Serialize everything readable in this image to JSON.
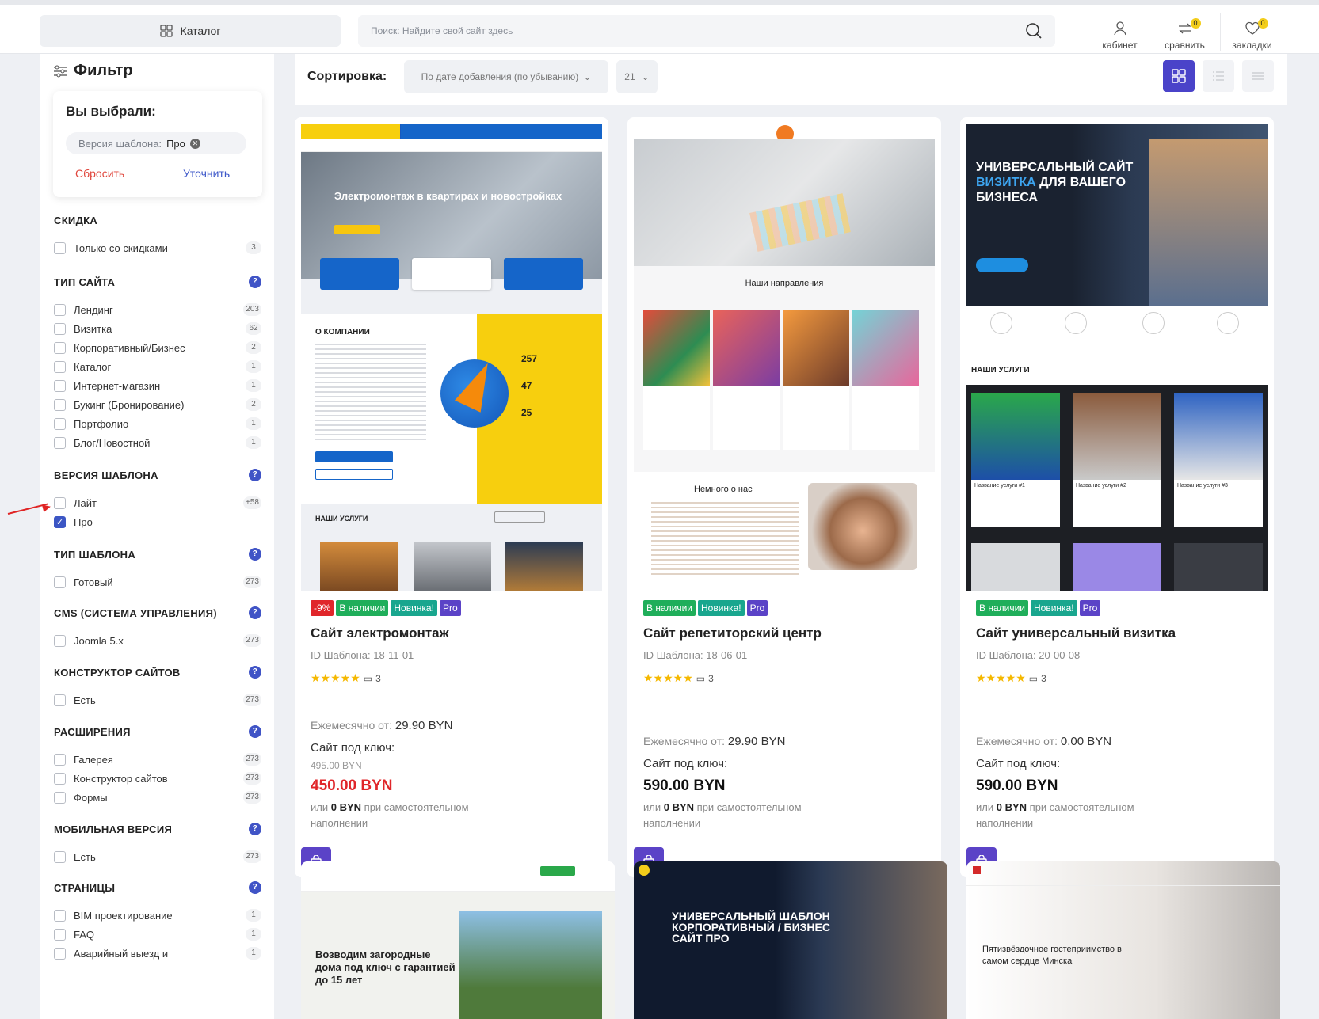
{
  "header": {
    "catalog_label": "Каталог",
    "search_placeholder": "Поиск: Найдите свой сайт здесь",
    "tools": [
      {
        "label": "кабинет",
        "icon": "user-icon"
      },
      {
        "label": "сравнить",
        "icon": "compare-icon",
        "badge": "0"
      },
      {
        "label": "закладки",
        "icon": "heart-icon",
        "badge": "0"
      }
    ]
  },
  "sidebar": {
    "title": "Фильтр",
    "selected": {
      "title": "Вы выбрали:",
      "chip_key": "Версия шаблона:",
      "chip_value": "Про",
      "reset": "Сбросить",
      "refine": "Уточнить"
    },
    "groups": [
      {
        "title": "СКИДКА",
        "help": false,
        "options": [
          {
            "label": "Только со скидками",
            "count": "3",
            "checked": false
          }
        ]
      },
      {
        "title": "ТИП САЙТА",
        "help": true,
        "options": [
          {
            "label": "Лендинг",
            "count": "203",
            "checked": false
          },
          {
            "label": "Визитка",
            "count": "62",
            "checked": false
          },
          {
            "label": "Корпоративный/Бизнес",
            "count": "2",
            "checked": false
          },
          {
            "label": "Каталог",
            "count": "1",
            "checked": false
          },
          {
            "label": "Интернет-магазин",
            "count": "1",
            "checked": false
          },
          {
            "label": "Букинг (Бронирование)",
            "count": "2",
            "checked": false
          },
          {
            "label": "Портфолио",
            "count": "1",
            "checked": false
          },
          {
            "label": "Блог/Новостной",
            "count": "1",
            "checked": false
          }
        ]
      },
      {
        "title": "ВЕРСИЯ ШАБЛОНА",
        "help": true,
        "options": [
          {
            "label": "Лайт",
            "count": "+58",
            "checked": false
          },
          {
            "label": "Про",
            "count": "",
            "checked": true
          }
        ]
      },
      {
        "title": "ТИП ШАБЛОНА",
        "help": true,
        "options": [
          {
            "label": "Готовый",
            "count": "273",
            "checked": false
          }
        ]
      },
      {
        "title": "CMS (СИСТЕМА УПРАВЛЕНИЯ)",
        "help": true,
        "options": [
          {
            "label": "Joomla 5.x",
            "count": "273",
            "checked": false
          }
        ]
      },
      {
        "title": "КОНСТРУКТОР САЙТОВ",
        "help": true,
        "options": [
          {
            "label": "Есть",
            "count": "273",
            "checked": false
          }
        ]
      },
      {
        "title": "РАСШИРЕНИЯ",
        "help": true,
        "options": [
          {
            "label": "Галерея",
            "count": "273",
            "checked": false
          },
          {
            "label": "Конструктор сайтов",
            "count": "273",
            "checked": false
          },
          {
            "label": "Формы",
            "count": "273",
            "checked": false
          }
        ]
      },
      {
        "title": "МОБИЛЬНАЯ ВЕРСИЯ",
        "help": true,
        "options": [
          {
            "label": "Есть",
            "count": "273",
            "checked": false
          }
        ]
      },
      {
        "title": "СТРАНИЦЫ",
        "help": true,
        "options": [
          {
            "label": "BIM проектирование",
            "count": "1",
            "checked": false
          },
          {
            "label": "FAQ",
            "count": "1",
            "checked": false
          },
          {
            "label": "Аварийный выезд и",
            "count": "1",
            "checked": false
          }
        ]
      }
    ]
  },
  "sort": {
    "label": "Сортировка:",
    "value": "По дате добавления (по убыванию)",
    "per_page": "21"
  },
  "cards": [
    {
      "badges": [
        {
          "t": "-9%",
          "c": "red"
        },
        {
          "t": "В наличии",
          "c": "green"
        },
        {
          "t": "Новинка!",
          "c": "teal"
        },
        {
          "t": "Pro",
          "c": "pro"
        }
      ],
      "title": "Сайт электромонтаж",
      "id": "ID Шаблона: 18-11-01",
      "stars": "★★★★★",
      "reviews": "3",
      "monthly_label": "Ежемесячно от:",
      "monthly": "29.90 BYN",
      "key_label": "Сайт под ключ:",
      "old_price": "495.00 BYN",
      "price": "450.00 BYN",
      "note_pre": "или",
      "note_b": "0 BYN",
      "note_post": "при самостоятельном наполнении"
    },
    {
      "badges": [
        {
          "t": "В наличии",
          "c": "green"
        },
        {
          "t": "Новинка!",
          "c": "teal"
        },
        {
          "t": "Pro",
          "c": "pro"
        }
      ],
      "title": "Сайт репетиторский центр",
      "id": "ID Шаблона: 18-06-01",
      "stars": "★★★★★",
      "reviews": "3",
      "monthly_label": "Ежемесячно от:",
      "monthly": "29.90 BYN",
      "key_label": "Сайт под ключ:",
      "old_price": "",
      "price": "590.00 BYN",
      "note_pre": "или",
      "note_b": "0 BYN",
      "note_post": "при самостоятельном наполнении"
    },
    {
      "badges": [
        {
          "t": "В наличии",
          "c": "green"
        },
        {
          "t": "Новинка!",
          "c": "teal"
        },
        {
          "t": "Pro",
          "c": "pro"
        }
      ],
      "title": "Сайт универсальный визитка",
      "id": "ID Шаблона: 20-00-08",
      "stars": "★★★★★",
      "reviews": "3",
      "monthly_label": "Ежемесячно от:",
      "monthly": "0.00 BYN",
      "key_label": "Сайт под ключ:",
      "old_price": "",
      "price": "590.00 BYN",
      "note_pre": "или",
      "note_b": "0 BYN",
      "note_post": "при самостоятельном наполнении"
    }
  ],
  "previews": {
    "c1": {
      "hero": "Электромонтаж в квартирах и новостройках",
      "about": "О КОМПАНИИ",
      "stats": [
        "257",
        "47",
        "25"
      ],
      "services": "НАШИ УСЛУГИ"
    },
    "c2": {
      "dirs": "Наши направления",
      "about": "Немного о нас"
    },
    "c3": {
      "hero_l1": "УНИВЕРСАЛЬНЫЙ САЙТ",
      "hero_accent": "ВИЗИТКА",
      "hero_l2": " ДЛЯ ВАШЕГО",
      "hero_l3": "БИЗНЕСА",
      "services": "НАШИ УСЛУГИ",
      "svc": [
        "Название услуги #1",
        "Название услуги #2",
        "Название услуги #3"
      ]
    },
    "r2a": "Возводим загородные дома под ключ с гарантией до 15 лет",
    "r2b": [
      "УНИВЕРСАЛЬНЫЙ ШАБЛОН",
      "КОРПОРАТИВНЫЙ / БИЗНЕС",
      "САЙТ ПРО"
    ],
    "r2c": "Пятизвёздочное гостеприимство в самом сердце Минска"
  },
  "colors": {
    "accent": "#5b43c7",
    "primary": "#4054c6",
    "sale": "#e0262a",
    "instock": "#1fae5a",
    "new": "#19a68e"
  }
}
